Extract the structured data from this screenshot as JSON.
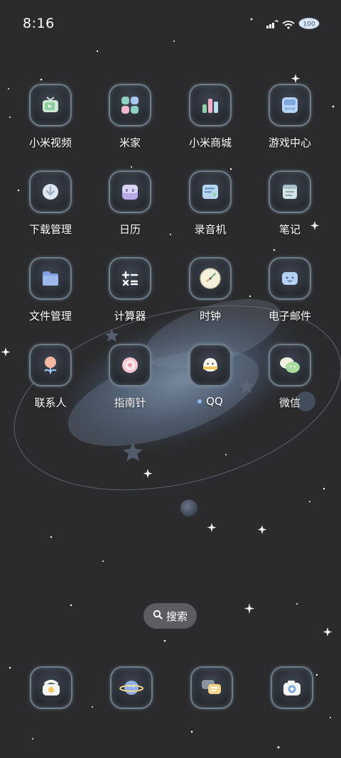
{
  "status_bar": {
    "time": "8:16",
    "icons": [
      "signal-icon",
      "wifi-icon",
      "battery-icon"
    ],
    "battery_level": "100"
  },
  "apps": [
    {
      "label": "小米视频",
      "icon": "tv-icon"
    },
    {
      "label": "米家",
      "icon": "grid-icon"
    },
    {
      "label": "小米商城",
      "icon": "bar-chart-icon"
    },
    {
      "label": "游戏中心",
      "icon": "gamepad-icon"
    },
    {
      "label": "下载管理",
      "icon": "download-icon"
    },
    {
      "label": "日历",
      "icon": "calendar-icon"
    },
    {
      "label": "录音机",
      "icon": "recorder-icon"
    },
    {
      "label": "笔记",
      "icon": "notes-icon"
    },
    {
      "label": "文件管理",
      "icon": "folder-icon"
    },
    {
      "label": "计算器",
      "icon": "calculator-icon"
    },
    {
      "label": "时钟",
      "icon": "clock-icon"
    },
    {
      "label": "电子邮件",
      "icon": "mail-icon"
    },
    {
      "label": "联系人",
      "icon": "flower-icon"
    },
    {
      "label": "指南针",
      "icon": "compass-icon"
    },
    {
      "label": "QQ",
      "icon": "qq-penguin-icon",
      "badge": "dot"
    },
    {
      "label": "微信",
      "icon": "wechat-icon"
    }
  ],
  "search": {
    "label": "搜索",
    "icon": "search-icon"
  },
  "dock": [
    {
      "icon": "phone-icon"
    },
    {
      "icon": "browser-planet-icon"
    },
    {
      "icon": "messages-icon"
    },
    {
      "icon": "camera-icon"
    }
  ],
  "colors": {
    "background": "#2b2b2d",
    "icon_glow": "#c8e1f5",
    "badge_dot": "#8fb8f0"
  }
}
